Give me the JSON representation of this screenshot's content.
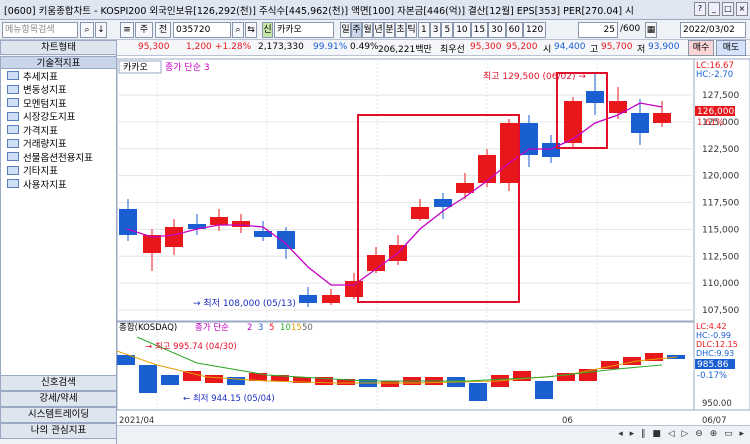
{
  "window": {
    "title": "[0600] 키움종합차트 - KOSPI200 외국인보유[126,292(천)] 주식수[445,962(천)] 액면[100] 자본금[446(억)] 결산[12월] EPS[353] PER[270.04] 시"
  },
  "toolbar": {
    "search_placeholder": "메뉴항목검색",
    "period_label": "주",
    "prev_label": "전",
    "code": "035720",
    "name": "카카오",
    "period_tabs": [
      "일",
      "주",
      "월",
      "년",
      "분",
      "초",
      "틱"
    ],
    "number_tabs": [
      "1",
      "3",
      "5",
      "10",
      "15",
      "30",
      "60",
      "120"
    ],
    "count": "25",
    "total": "600",
    "date": "2022/03/02"
  },
  "quote": {
    "price": "95,300",
    "change": "1,200",
    "rate": "+1.28%",
    "volume": "2,173,330",
    "vol_rate": "99.91%",
    "turnover": "0.49%",
    "amount": "206,221백만",
    "ask_label": "최우선",
    "ask": "95,300",
    "bid": "95,200",
    "open_label": "시",
    "open": "94,400",
    "high_label": "고",
    "high": "95,700",
    "low_label": "저",
    "low": "93,900",
    "buy_label": "매수",
    "sell_label": "매도"
  },
  "sidebar": {
    "tab_chart": "차트형태",
    "tab_tech": "기술적지표",
    "items": [
      "추세지표",
      "변동성지표",
      "모멘텀지표",
      "시장강도지표",
      "가격지표",
      "거래량지표",
      "선물옵션전용지표",
      "기타지표",
      "사용자지표"
    ],
    "bottom": [
      "신호검색",
      "강세/약세",
      "시스템트레이딩",
      "나의 관심지표"
    ]
  },
  "upper_chart": {
    "legend_name": "카카오",
    "legend_ma": "종가 단순 3",
    "lc": "LC:16.67",
    "hc": "HC:-2.70",
    "cur_price": "126,000",
    "cur_rate": "1.61%",
    "high_note": "최고 129,500 (06/02)",
    "low_note": "최저 108,000 (05/13)",
    "y_ticks": [
      "127,500",
      "125,000",
      "122,500",
      "120,000",
      "117,500",
      "115,000",
      "112,500",
      "110,000",
      "107,500"
    ]
  },
  "lower_chart": {
    "legend_name": "종합(KOSDAQ)",
    "legend_ma": "종가 단순",
    "legend_periods": [
      "2",
      "3",
      "5",
      "10",
      "15",
      "50"
    ],
    "lc": "LC:4.42",
    "hc": "HC:-0.99",
    "dlc": "DLC:12.15",
    "dhc": "DHC:9.93",
    "cur_value": "985.86",
    "cur_rate": "-0.17%",
    "high_note": "최고 995.74 (04/30)",
    "low_note": "최저 944.15 (05/04)",
    "y_ticks": [
      "950.00"
    ]
  },
  "x_axis": {
    "labels": [
      "2021/04",
      "06",
      "06/07"
    ]
  },
  "colors": {
    "up": "#e8171c",
    "down": "#1a5fd1",
    "ma": "#c400c4",
    "box": "#e0102a"
  }
}
